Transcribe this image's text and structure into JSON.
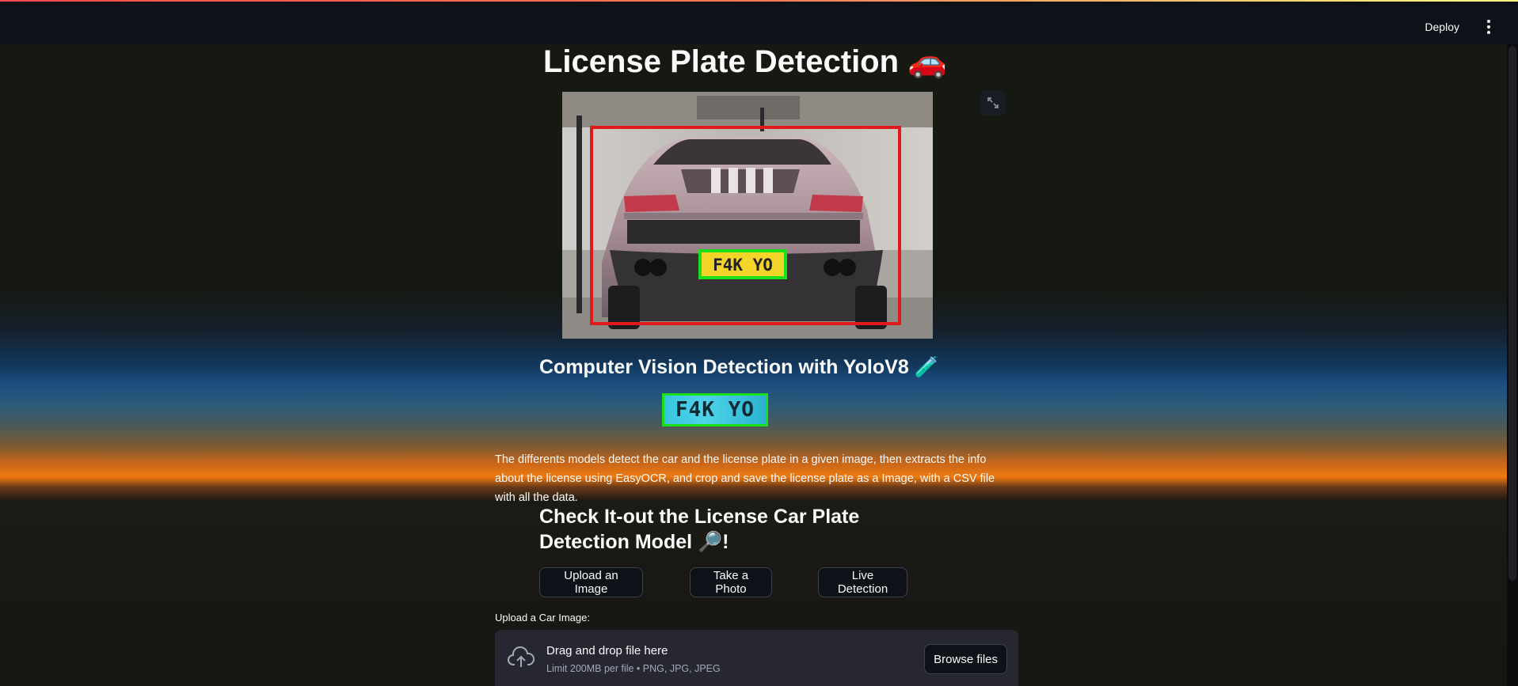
{
  "header": {
    "deploy_label": "Deploy",
    "menu_icon": "kebab-menu-icon"
  },
  "page": {
    "title": "License Plate Detection",
    "title_emoji": "🚗",
    "heading": "Computer Vision Detection with YoloV8",
    "heading_emoji": "🧪",
    "plate_text": "F4K YO",
    "description": "The differents models detect the car and the license plate in a given image, then extracts the info about the license using EasyOCR, and crop and save the license plate as a Image, with a CSV file with all the data.",
    "cta_heading": "Check It-out the License Car Plate Detection Model",
    "cta_emoji": "🔎",
    "cta_suffix": "!"
  },
  "tabs": [
    {
      "label": "Upload an Image"
    },
    {
      "label": "Take a Photo"
    },
    {
      "label": "Live Detection"
    }
  ],
  "uploader": {
    "label": "Upload a Car Image:",
    "drop_title": "Drag and drop file here",
    "limit_text": "Limit 200MB per file • PNG, JPG, JPEG",
    "browse_label": "Browse files"
  },
  "colors": {
    "car_box": "#e0191c",
    "plate_box": "#19e019",
    "header_bg": "#0e1117",
    "dropzone_bg": "#262730"
  }
}
